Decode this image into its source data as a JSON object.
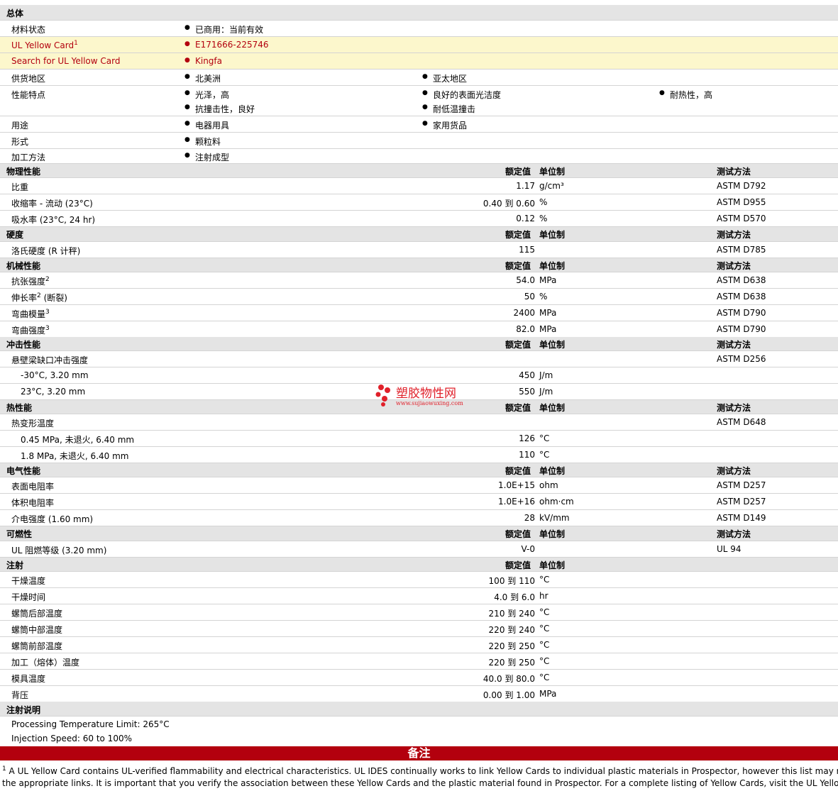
{
  "general": {
    "header": "总体",
    "material_status": {
      "label": "材料状态",
      "value": "已商用：当前有效"
    },
    "ul_card": {
      "label": "UL Yellow Card",
      "sup": "1",
      "value": "E171666-225746"
    },
    "ul_search": {
      "label": "Search for UL Yellow Card",
      "value": "Kingfa"
    },
    "supply": {
      "label": "供货地区",
      "values": [
        "北美洲",
        "亚太地区"
      ]
    },
    "features": {
      "label": "性能特点",
      "values": [
        "光泽，高",
        "良好的表面光洁度",
        "耐热性，高",
        "抗撞击性，良好",
        "耐低温撞击"
      ]
    },
    "uses": {
      "label": "用途",
      "values": [
        "电器用具",
        "家用货品"
      ]
    },
    "form": {
      "label": "形式",
      "value": "颗粒料"
    },
    "processing": {
      "label": "加工方法",
      "value": "注射成型"
    }
  },
  "col_headers": {
    "nominal": "额定值",
    "unit": "单位制",
    "method": "测试方法"
  },
  "physical": {
    "header": "物理性能",
    "rows": [
      {
        "label": "比重",
        "value": "1.17",
        "unit": "g/cm³",
        "method": "ASTM D792"
      },
      {
        "label": "收缩率 - 流动 (23°C)",
        "value": "0.40 到  0.60",
        "unit": "%",
        "method": "ASTM D955"
      },
      {
        "label": "吸水率 (23°C, 24 hr)",
        "value": "0.12",
        "unit": "%",
        "method": "ASTM D570"
      }
    ]
  },
  "hardness": {
    "header": "硬度",
    "rows": [
      {
        "label": "洛氏硬度 (R 计秤)",
        "value": "115",
        "unit": "",
        "method": "ASTM D785"
      }
    ]
  },
  "mechanical": {
    "header": "机械性能",
    "rows": [
      {
        "label": "抗张强度",
        "sup": "2",
        "label_after": "",
        "value": "54.0",
        "unit": "MPa",
        "method": "ASTM D638"
      },
      {
        "label": "伸长率",
        "sup": "2",
        "label_after": " (断裂)",
        "value": "50",
        "unit": "%",
        "method": "ASTM D638"
      },
      {
        "label": "弯曲模量",
        "sup": "3",
        "label_after": "",
        "value": "2400",
        "unit": "MPa",
        "method": "ASTM D790"
      },
      {
        "label": "弯曲强度",
        "sup": "3",
        "label_after": "",
        "value": "82.0",
        "unit": "MPa",
        "method": "ASTM D790"
      }
    ]
  },
  "impact": {
    "header": "冲击性能",
    "title_row": {
      "label": "悬壁梁缺口冲击强度",
      "method": "ASTM D256"
    },
    "rows": [
      {
        "label": "-30°C, 3.20 mm",
        "value": "450",
        "unit": "J/m"
      },
      {
        "label": "23°C, 3.20 mm",
        "value": "550",
        "unit": "J/m"
      }
    ]
  },
  "thermal": {
    "header": "热性能",
    "title_row": {
      "label": "热变形温度",
      "method": "ASTM D648"
    },
    "rows": [
      {
        "label": "0.45 MPa, 未退火, 6.40 mm",
        "value": "126",
        "unit": "°C"
      },
      {
        "label": "1.8 MPa, 未退火, 6.40 mm",
        "value": "110",
        "unit": "°C"
      }
    ]
  },
  "electrical": {
    "header": "电气性能",
    "rows": [
      {
        "label": "表面电阻率",
        "value": "1.0E+15",
        "unit": "ohm",
        "method": "ASTM D257"
      },
      {
        "label": "体积电阻率",
        "value": "1.0E+16",
        "unit": "ohm·cm",
        "method": "ASTM D257"
      },
      {
        "label": "介电强度 (1.60 mm)",
        "value": "28",
        "unit": "kV/mm",
        "method": "ASTM D149"
      }
    ]
  },
  "flammability": {
    "header": "可燃性",
    "rows": [
      {
        "label": "UL 阻燃等级 (3.20 mm)",
        "value": "V-0",
        "unit": "",
        "method": "UL 94"
      }
    ]
  },
  "injection": {
    "header": "注射",
    "rows": [
      {
        "label": "干燥温度",
        "value": "100 到  110",
        "unit": "°C"
      },
      {
        "label": "干燥时间",
        "value": "4.0 到  6.0",
        "unit": "hr"
      },
      {
        "label": "螺筒后部温度",
        "value": "210 到  240",
        "unit": "°C"
      },
      {
        "label": "螺筒中部温度",
        "value": "220 到  240",
        "unit": "°C"
      },
      {
        "label": "螺筒前部温度",
        "value": "220 到  250",
        "unit": "°C"
      },
      {
        "label": "加工（熔体）温度",
        "value": "220 到  250",
        "unit": "°C"
      },
      {
        "label": "模具温度",
        "value": "40.0 到  80.0",
        "unit": "°C"
      },
      {
        "label": "背压",
        "value": "0.00 到  1.00",
        "unit": "MPa"
      }
    ]
  },
  "injection_notes": {
    "header": "注射说明",
    "lines": [
      "Processing Temperature Limit: 265°C",
      "Injection Speed: 60 to 100%"
    ]
  },
  "notes": {
    "banner": "备注",
    "sup": "1",
    "line1": " A UL Yellow Card contains UL-verified flammability and electrical characteristics. UL IDES continually works to link Yellow Cards to individual plastic materials in Prospector, however this list may not in",
    "line2": "the appropriate links. It is important that you verify the association between these Yellow Cards and the plastic material found in Prospector. For a complete listing of Yellow Cards, visit the UL Yellow Card"
  },
  "watermark": {
    "text": "塑胶物性网",
    "url": "www.sujiaowuxing.com",
    "color": "#e0202a"
  }
}
